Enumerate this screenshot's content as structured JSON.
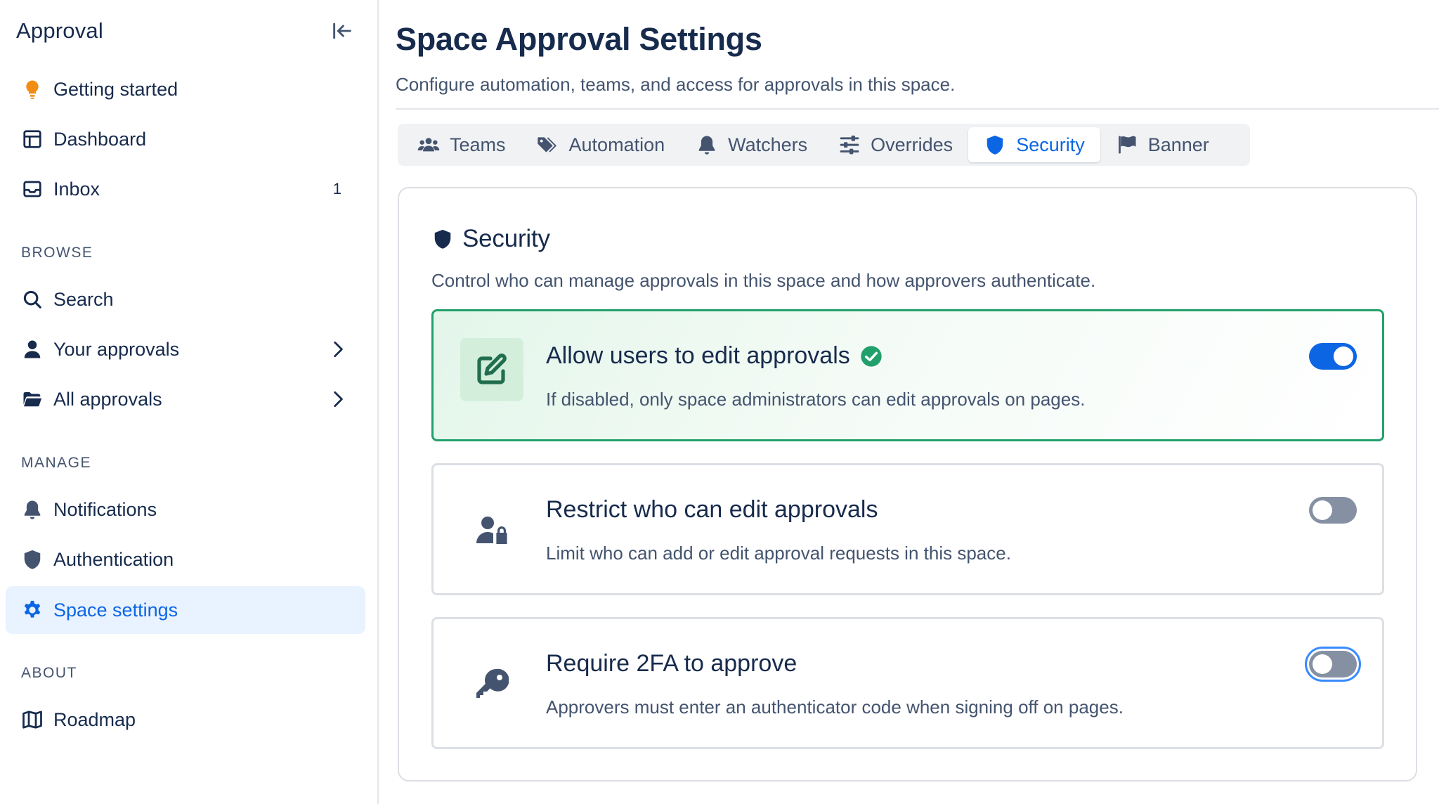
{
  "sidebar": {
    "title": "Approval",
    "collapse_icon": "collapse-left-icon",
    "top_items": [
      {
        "label": "Getting started",
        "icon": "lightbulb-icon"
      },
      {
        "label": "Dashboard",
        "icon": "dashboard-icon"
      },
      {
        "label": "Inbox",
        "icon": "inbox-icon",
        "badge": "1"
      }
    ],
    "browse_label": "BROWSE",
    "browse_items": [
      {
        "label": "Search",
        "icon": "search-icon"
      },
      {
        "label": "Your approvals",
        "icon": "person-icon"
      },
      {
        "label": "All approvals",
        "icon": "folder-open-icon"
      }
    ],
    "manage_label": "MANAGE",
    "manage_items": [
      {
        "label": "Notifications",
        "icon": "bell-icon"
      },
      {
        "label": "Authentication",
        "icon": "shield-icon"
      },
      {
        "label": "Space settings",
        "icon": "gear-icon",
        "active": true
      }
    ],
    "about_label": "ABOUT",
    "about_items": [
      {
        "label": "Roadmap",
        "icon": "map-icon"
      }
    ]
  },
  "page": {
    "title": "Space Approval Settings",
    "subtitle": "Configure automation, teams, and access for approvals in this space."
  },
  "tabs": [
    {
      "label": "Teams",
      "icon": "users-icon"
    },
    {
      "label": "Automation",
      "icon": "tags-icon"
    },
    {
      "label": "Watchers",
      "icon": "bell-icon"
    },
    {
      "label": "Overrides",
      "icon": "sliders-icon"
    },
    {
      "label": "Security",
      "icon": "shield-icon",
      "active": true
    },
    {
      "label": "Banner",
      "icon": "flag-icon"
    }
  ],
  "security": {
    "title": "Security",
    "description": "Control who can manage approvals in this space and how approvers authenticate.",
    "options": [
      {
        "title": "Allow users to edit approvals",
        "description": "If disabled, only space administrators can edit approvals on pages.",
        "enabled": true,
        "icon": "edit-icon"
      },
      {
        "title": "Restrict who can edit approvals",
        "description": "Limit who can add or edit approval requests in this space.",
        "enabled": false,
        "icon": "user-lock-icon"
      },
      {
        "title": "Require 2FA to approve",
        "description": "Approvers must enter an authenticator code when signing off on pages.",
        "enabled": false,
        "icon": "key-icon"
      }
    ]
  },
  "colors": {
    "accent": "#0c66e4",
    "success": "#22a06b",
    "orange": "#f18d13",
    "icon": "#44546f"
  }
}
